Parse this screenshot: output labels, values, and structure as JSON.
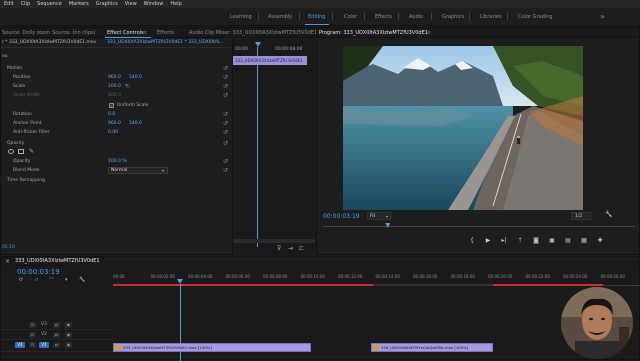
{
  "menubar": [
    "Edit",
    "Clip",
    "Sequence",
    "Markers",
    "Graphics",
    "View",
    "Window",
    "Help"
  ],
  "workspaces": {
    "items": [
      "Learning",
      "Assembly",
      "Editing",
      "Color",
      "Effects",
      "Audio",
      "Graphics",
      "Libraries",
      "Color Grading"
    ],
    "active": "Editing"
  },
  "source_panel": {
    "tabs": [
      "Source: Dolly zoom",
      "Source: (no clips)",
      "Effect Controls",
      "Effects",
      "Audio Clip Mixer: 333_UDXl0tA3XlzlwMTZfU3V0dE1"
    ],
    "active_tab": "Effect Controls",
    "clip_selector": "r * 333_UDXl0tA3XlzlwMTZfU3V0dE1.mov",
    "clip_path": "333_UDXl0tA3XlzlwMTZfU3V0dE1 * 333_UDXl0tAL..",
    "header_time_start": "00:00",
    "header_time_end": "00:00:08:00",
    "mini_clip_label": "333_UDXl0tA3XlzlwMTZfU3V0dE1",
    "section_video": "eo",
    "motion": {
      "heading": "Motion",
      "position_label": "Position",
      "position_x": "960.0",
      "position_y": "540.0",
      "scale_label": "Scale",
      "scale_value": "100.0",
      "scale_width_label": "Scale Width",
      "scale_width_value": "100.0",
      "uniform_label": "Uniform Scale",
      "rotation_label": "Rotation",
      "rotation_value": "0.0",
      "anchor_label": "Anchor Point",
      "anchor_x": "960.0",
      "anchor_y": "540.0",
      "flicker_label": "Anti-flicker Filter",
      "flicker_value": "0.00"
    },
    "opacity": {
      "heading": "Opacity",
      "opacity_label": "Opacity",
      "opacity_value": "100.0 %",
      "blend_label": "Blend Mode",
      "blend_value": "Normal"
    },
    "time_remap_label": "Time Remapping",
    "footer_time": "05:19"
  },
  "program": {
    "tab": "Program: 333_UDXl0tA3XlzlwMTZfU3V0dE1",
    "timecode": "00:00:03:19",
    "fit": "Fit",
    "resolution": "1/2",
    "playhead_fraction": 0.2
  },
  "timeline": {
    "tab": "333_UDXl0tA3XlzlwMTZfU3V0dE1",
    "timecode": "00:00:03:19",
    "ruler": [
      "00:00",
      "00:00:02:00",
      "00:00:04:00",
      "00:00:06:00",
      "00:00:08:00",
      "00:00:10:00",
      "00:00:12:00",
      "00:00:14:00",
      "00:00:16:00",
      "00:00:18:00",
      "00:00:20:00",
      "00:00:22:00",
      "00:00:24:00",
      "00:00:26:00"
    ],
    "tracks": [
      {
        "name": "V3",
        "src": ""
      },
      {
        "name": "V2",
        "src": ""
      },
      {
        "name": "V1",
        "src": "V1"
      }
    ],
    "clips": [
      {
        "label": "333_UDXl0tA3XlzlwMTZfU3V0dE1.mov [100%]"
      },
      {
        "label": "338_UDXl0tWLWTMYmZpQwMRA.mov [100%]"
      }
    ]
  },
  "colors": {
    "accent": "#4c9bea",
    "clip": "#a799e0",
    "value_blue": "#5aa9ff",
    "render_bar_red": "#cc2f2f"
  }
}
